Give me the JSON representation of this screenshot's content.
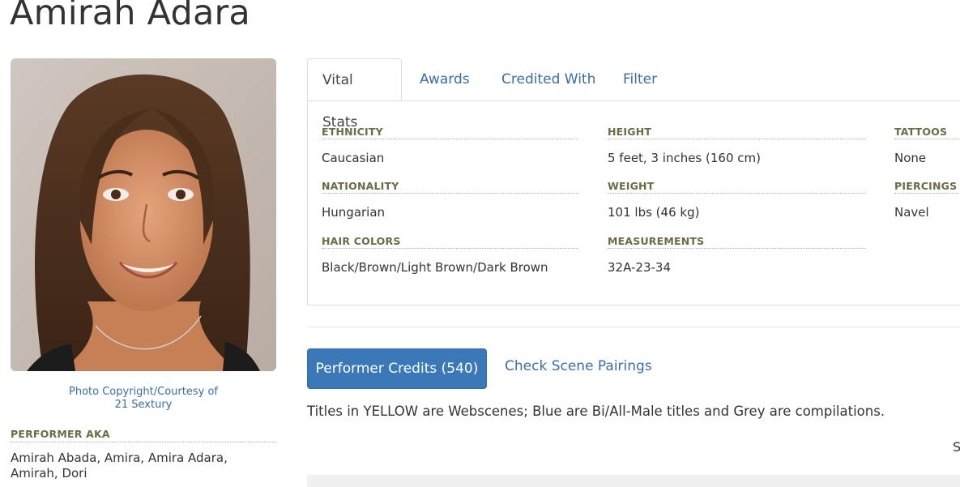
{
  "performer": {
    "name": "Amirah Adara",
    "photo_credit_line1": "Photo Copyright/Courtesy of",
    "photo_credit_line2": "21 Sextury",
    "aka_label": "PERFORMER AKA",
    "aka_value": "Amirah Abada, Amira, Amira Adara, Amirah, Dori"
  },
  "tabs": [
    {
      "label": "Vital Stats",
      "active": true
    },
    {
      "label": "Awards",
      "active": false
    },
    {
      "label": "Credited With",
      "active": false
    },
    {
      "label": "Filter",
      "active": false
    }
  ],
  "stats": {
    "ethnicity": {
      "label": "ETHNICITY",
      "value": "Caucasian"
    },
    "nationality": {
      "label": "NATIONALITY",
      "value": "Hungarian"
    },
    "hair_colors": {
      "label": "HAIR COLORS",
      "value": "Black/Brown/Light Brown/Dark Brown"
    },
    "height": {
      "label": "HEIGHT",
      "value": "5 feet, 3 inches (160 cm)"
    },
    "weight": {
      "label": "WEIGHT",
      "value": "101 lbs (46 kg)"
    },
    "measurements": {
      "label": "MEASUREMENTS",
      "value": "32A-23-34"
    },
    "tattoos": {
      "label": "TATTOOS",
      "value": "None"
    },
    "piercings": {
      "label": "PIERCINGS",
      "value": "Navel"
    }
  },
  "credits": {
    "button_label": "Performer Credits (540)",
    "pairings_label": "Check Scene Pairings",
    "legend_note": "Titles in YELLOW are Webscenes; Blue are Bi/All-Male titles and Grey are compilations.",
    "cut_text": "S"
  },
  "colors": {
    "link": "#3a6ea5",
    "button": "#3a78b8",
    "label": "#6b6b47"
  }
}
